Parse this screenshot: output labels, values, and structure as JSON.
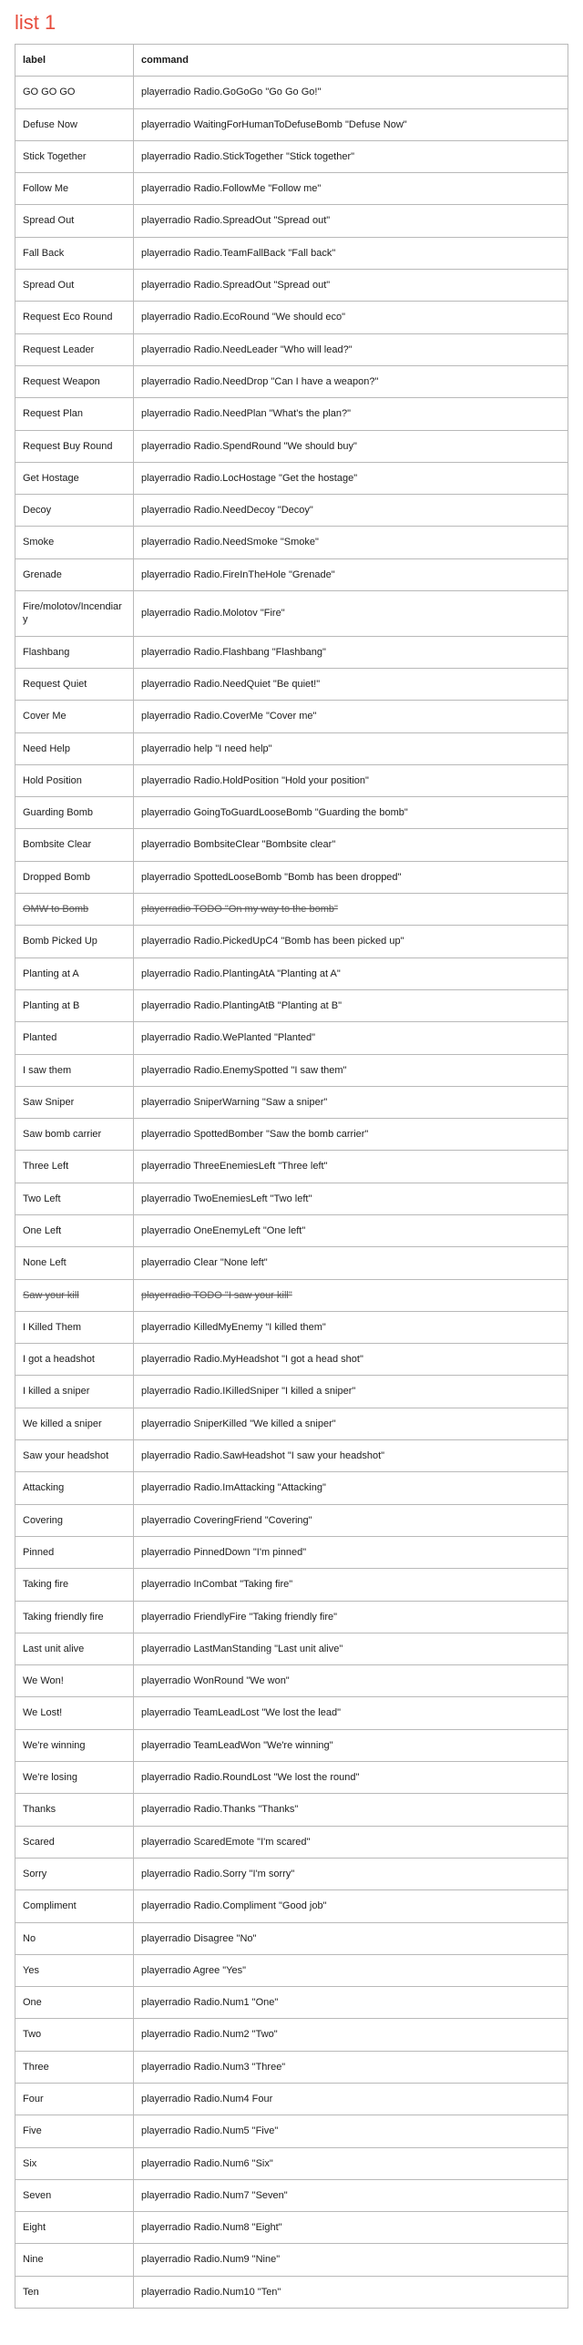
{
  "title": "list 1",
  "columns": {
    "label": "label",
    "command": "command"
  },
  "rows": [
    {
      "label": "GO GO GO",
      "command": "playerradio Radio.GoGoGo \"Go Go Go!\""
    },
    {
      "label": "Defuse Now",
      "command": "playerradio WaitingForHumanToDefuseBomb \"Defuse Now\""
    },
    {
      "label": "Stick Together",
      "command": "playerradio Radio.StickTogether \"Stick together\""
    },
    {
      "label": "Follow Me",
      "command": "playerradio Radio.FollowMe \"Follow me\""
    },
    {
      "label": "Spread Out",
      "command": "playerradio Radio.SpreadOut \"Spread out\""
    },
    {
      "label": "Fall Back",
      "command": "playerradio Radio.TeamFallBack \"Fall back\""
    },
    {
      "label": "Spread Out",
      "command": "playerradio Radio.SpreadOut \"Spread out\""
    },
    {
      "label": "Request Eco Round",
      "command": "playerradio Radio.EcoRound \"We should eco\""
    },
    {
      "label": "Request Leader",
      "command": "playerradio Radio.NeedLeader \"Who will lead?\""
    },
    {
      "label": "Request Weapon",
      "command": "playerradio Radio.NeedDrop \"Can I have a weapon?\""
    },
    {
      "label": "Request Plan",
      "command": "playerradio Radio.NeedPlan \"What's the plan?\""
    },
    {
      "label": "Request Buy Round",
      "command": "playerradio Radio.SpendRound \"We should buy\""
    },
    {
      "label": "Get Hostage",
      "command": "playerradio Radio.LocHostage \"Get the hostage\""
    },
    {
      "label": "Decoy",
      "command": "playerradio Radio.NeedDecoy \"Decoy\""
    },
    {
      "label": "Smoke",
      "command": "playerradio Radio.NeedSmoke \"Smoke\""
    },
    {
      "label": "Grenade",
      "command": "playerradio Radio.FireInTheHole \"Grenade\""
    },
    {
      "label": "Fire/molotov/Incendiary",
      "command": "playerradio Radio.Molotov \"Fire\""
    },
    {
      "label": "Flashbang",
      "command": "playerradio Radio.Flashbang \"Flashbang\""
    },
    {
      "label": "Request Quiet",
      "command": "playerradio Radio.NeedQuiet \"Be quiet!\""
    },
    {
      "label": "Cover Me",
      "command": "playerradio Radio.CoverMe \"Cover me\""
    },
    {
      "label": "Need Help",
      "command": "playerradio help \"I need help\""
    },
    {
      "label": "Hold Position",
      "command": "playerradio Radio.HoldPosition \"Hold your position\""
    },
    {
      "label": "Guarding Bomb",
      "command": "playerradio GoingToGuardLooseBomb \"Guarding the bomb\""
    },
    {
      "label": "Bombsite Clear",
      "command": "playerradio BombsiteClear \"Bombsite clear\""
    },
    {
      "label": "Dropped Bomb",
      "command": "playerradio SpottedLooseBomb \"Bomb has been dropped\""
    },
    {
      "label": "OMW to Bomb",
      "command": "playerradio TODO \"On my way to the bomb\"",
      "strike": true
    },
    {
      "label": "Bomb Picked Up",
      "command": "playerradio Radio.PickedUpC4 \"Bomb has been picked up\""
    },
    {
      "label": "Planting at A",
      "command": "playerradio Radio.PlantingAtA \"Planting at A\""
    },
    {
      "label": "Planting at B",
      "command": "playerradio Radio.PlantingAtB \"Planting at B\""
    },
    {
      "label": "Planted",
      "command": "playerradio Radio.WePlanted \"Planted\""
    },
    {
      "label": "I saw them",
      "command": "playerradio Radio.EnemySpotted \"I saw them\""
    },
    {
      "label": "Saw Sniper",
      "command": "playerradio SniperWarning \"Saw a sniper\""
    },
    {
      "label": "Saw bomb carrier",
      "command": "playerradio SpottedBomber \"Saw the bomb carrier\""
    },
    {
      "label": "Three Left",
      "command": "playerradio ThreeEnemiesLeft \"Three left\""
    },
    {
      "label": "Two Left",
      "command": "playerradio TwoEnemiesLeft \"Two left\""
    },
    {
      "label": "One Left",
      "command": "playerradio OneEnemyLeft \"One left\""
    },
    {
      "label": "None Left",
      "command": "playerradio Clear \"None left\""
    },
    {
      "label": "Saw your kill",
      "command": "playerradio TODO \"I saw your kill\"",
      "strike": true
    },
    {
      "label": "I Killed Them",
      "command": "playerradio KilledMyEnemy \"I killed them\""
    },
    {
      "label": "I got a headshot",
      "command": "playerradio Radio.MyHeadshot \"I got a head shot\""
    },
    {
      "label": "I killed a sniper",
      "command": "playerradio Radio.IKilledSniper \"I killed a sniper\""
    },
    {
      "label": "We killed a sniper",
      "command": "playerradio SniperKilled \"We killed a sniper\""
    },
    {
      "label": "Saw your headshot",
      "command": "playerradio Radio.SawHeadshot \"I saw your headshot\""
    },
    {
      "label": "Attacking",
      "command": "playerradio Radio.ImAttacking \"Attacking\""
    },
    {
      "label": "Covering",
      "command": "playerradio CoveringFriend \"Covering\""
    },
    {
      "label": "Pinned",
      "command": "playerradio PinnedDown \"I'm pinned\""
    },
    {
      "label": "Taking fire",
      "command": "playerradio InCombat \"Taking fire\""
    },
    {
      "label": "Taking friendly fire",
      "command": "playerradio FriendlyFire \"Taking friendly fire\""
    },
    {
      "label": "Last unit alive",
      "command": "playerradio LastManStanding \"Last unit alive\""
    },
    {
      "label": "We Won!",
      "command": "playerradio WonRound \"We won\""
    },
    {
      "label": "We Lost!",
      "command": "playerradio TeamLeadLost \"We lost the lead\""
    },
    {
      "label": "We're winning",
      "command": "playerradio TeamLeadWon \"We're winning\""
    },
    {
      "label": "We're losing",
      "command": "playerradio Radio.RoundLost \"We lost the round\""
    },
    {
      "label": "Thanks",
      "command": "playerradio Radio.Thanks \"Thanks\""
    },
    {
      "label": "Scared",
      "command": "playerradio ScaredEmote \"I'm scared\""
    },
    {
      "label": "Sorry",
      "command": "playerradio Radio.Sorry \"I'm sorry\""
    },
    {
      "label": "Compliment",
      "command": "playerradio Radio.Compliment \"Good job\""
    },
    {
      "label": "No",
      "command": "playerradio Disagree \"No\""
    },
    {
      "label": "Yes",
      "command": "playerradio Agree \"Yes\""
    },
    {
      "label": "One",
      "command": "playerradio Radio.Num1 \"One\""
    },
    {
      "label": "Two",
      "command": "playerradio Radio.Num2 \"Two\""
    },
    {
      "label": "Three",
      "command": "playerradio Radio.Num3 \"Three\""
    },
    {
      "label": "Four",
      "command": "playerradio Radio.Num4 Four"
    },
    {
      "label": "Five",
      "command": "playerradio Radio.Num5 \"Five\""
    },
    {
      "label": "Six",
      "command": "playerradio Radio.Num6 \"Six\""
    },
    {
      "label": "Seven",
      "command": "playerradio Radio.Num7 \"Seven\""
    },
    {
      "label": "Eight",
      "command": "playerradio Radio.Num8 \"Eight\""
    },
    {
      "label": "Nine",
      "command": "playerradio Radio.Num9 \"Nine\""
    },
    {
      "label": "Ten",
      "command": "playerradio Radio.Num10 \"Ten\""
    }
  ]
}
